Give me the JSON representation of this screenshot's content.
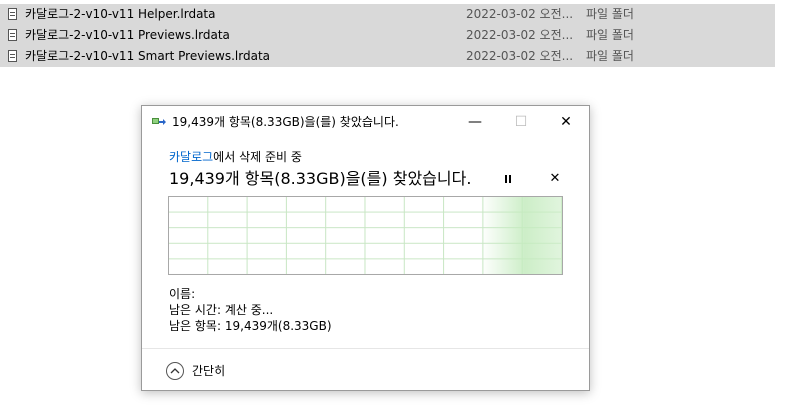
{
  "files": [
    {
      "name": "카달로그-2-v10-v11 Helper.lrdata",
      "date": "2022-03-02 오전...",
      "type": "파일 폴더",
      "icon": "folder-file-icon"
    },
    {
      "name": "카달로그-2-v10-v11 Previews.lrdata",
      "date": "2022-03-02 오전...",
      "type": "파일 폴더",
      "icon": "folder-file-icon"
    },
    {
      "name": "카달로그-2-v10-v11 Smart Previews.lrdata",
      "date": "2022-03-02 오전...",
      "type": "파일 폴더",
      "icon": "folder-file-icon"
    }
  ],
  "dialog": {
    "title": "19,439개 항목(8.33GB)을(를) 찾았습니다.",
    "minimize_glyph": "—",
    "maximize_glyph": "☐",
    "close_glyph": "✕",
    "operation_link": "카달로그",
    "operation_text": "에서 삭제 준비 중",
    "status": "19,439개 항목(8.33GB)을(를) 찾았습니다.",
    "cancel_glyph": "✕",
    "details": {
      "name_label": "이름:",
      "name_value": "",
      "time_label": "남은 시간:",
      "time_value": "계산 중...",
      "items_label": "남은 항목:",
      "items_value": "19,439개(8.33GB)"
    },
    "less_details_label": "간단히"
  },
  "colors": {
    "row_selected": "#d9d9d9",
    "link_blue": "#0066cc",
    "graph_grid": "#c8e6c4",
    "graph_fill": "#c4ebbe"
  }
}
